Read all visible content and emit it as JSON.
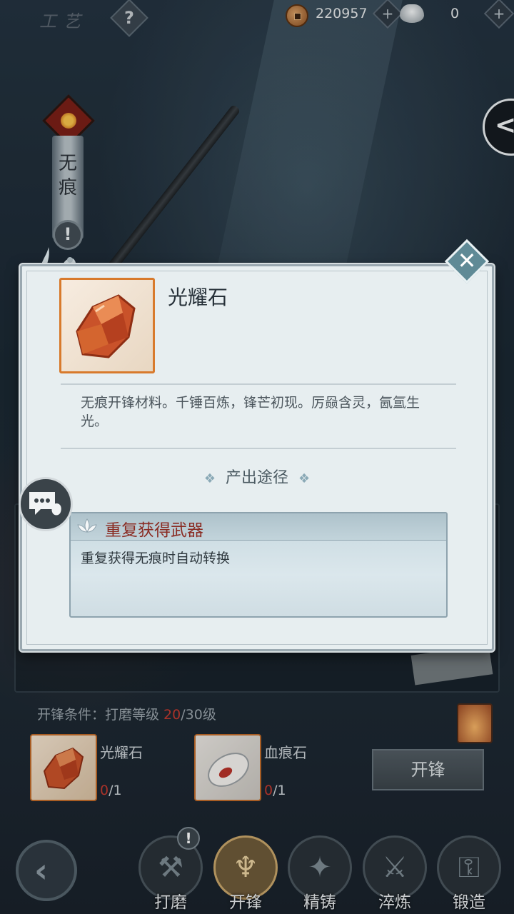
{
  "topbar": {
    "title": "工艺",
    "help_label": "?",
    "coins": "220957",
    "ingots": "0",
    "plus": "+"
  },
  "weapon": {
    "name": "无痕",
    "alert": "!"
  },
  "collapse_label": "<",
  "dialog": {
    "item_name": "光耀石",
    "description": "无痕开锋材料。千锤百炼，锋芒初现。厉赑含灵，氤氲生光。",
    "source_section_title": "产出途径",
    "ornament": "❖",
    "sources": [
      {
        "name": "重复获得武器",
        "description": "重复获得无痕时自动转换"
      }
    ],
    "close_label": "✕"
  },
  "sharpen": {
    "condition_label": "开锋条件：打磨等级 ",
    "condition_current": "20",
    "condition_required": "/30级",
    "materials": [
      {
        "name": "光耀石",
        "have": "0",
        "need": "/1"
      },
      {
        "name": "血痕石",
        "have": "0",
        "need": "/1"
      }
    ],
    "button_label": "开锋"
  },
  "nav": {
    "back_label": "‹",
    "alert": "!",
    "tabs": [
      {
        "label": "打磨",
        "active": false
      },
      {
        "label": "开锋",
        "active": true
      },
      {
        "label": "精铸",
        "active": false
      },
      {
        "label": "淬炼",
        "active": false
      },
      {
        "label": "锻造",
        "active": false
      }
    ]
  },
  "colors": {
    "accent_red": "#c23a2f",
    "source_title_red": "#8a2c23",
    "dialog_bg": "#e7eef0",
    "item_frame_orange": "#d87a2c"
  }
}
